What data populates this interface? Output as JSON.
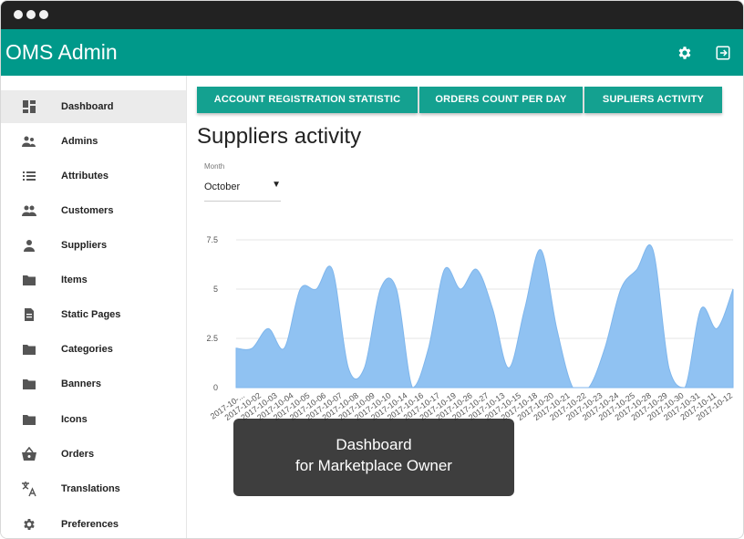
{
  "app": {
    "title": "OMS Admin"
  },
  "header": {
    "icons": [
      "settings-gear-icon",
      "logout-icon"
    ]
  },
  "sidebar": {
    "items": [
      {
        "label": "Dashboard",
        "icon": "dashboard-icon",
        "active": true
      },
      {
        "label": "Admins",
        "icon": "admins-icon"
      },
      {
        "label": "Attributes",
        "icon": "list-icon"
      },
      {
        "label": "Customers",
        "icon": "customers-icon"
      },
      {
        "label": "Suppliers",
        "icon": "person-icon"
      },
      {
        "label": "Items",
        "icon": "folder-icon"
      },
      {
        "label": "Static Pages",
        "icon": "document-icon"
      },
      {
        "label": "Categories",
        "icon": "folder-icon"
      },
      {
        "label": "Banners",
        "icon": "folder-icon"
      },
      {
        "label": "Icons",
        "icon": "folder-icon"
      },
      {
        "label": "Orders",
        "icon": "basket-icon"
      },
      {
        "label": "Translations",
        "icon": "translate-icon"
      },
      {
        "label": "Preferences",
        "icon": "gear-icon"
      }
    ]
  },
  "tabs": [
    {
      "label": "ACCOUNT REGISTRATION STATISTIC"
    },
    {
      "label": "ORDERS COUNT PER DAY"
    },
    {
      "label": "SUPLIERS ACTIVITY"
    }
  ],
  "main": {
    "title": "Suppliers activity",
    "month": {
      "label": "Month",
      "value": "October"
    }
  },
  "chart_data": {
    "type": "area",
    "x": [
      "2017-10-...",
      "2017-10-02",
      "2017-10-03",
      "2017-10-04",
      "2017-10-05",
      "2017-10-06",
      "2017-10-07",
      "2017-10-08",
      "2017-10-09",
      "2017-10-10",
      "2017-10-14",
      "2017-10-16",
      "2017-10-17",
      "2017-10-19",
      "2017-10-26",
      "2017-10-27",
      "2017-10-13",
      "2017-10-15",
      "2017-10-18",
      "2017-10-20",
      "2017-10-21",
      "2017-10-22",
      "2017-10-23",
      "2017-10-24",
      "2017-10-25",
      "2017-10-28",
      "2017-10-29",
      "2017-10-30",
      "2017-10-31",
      "2017-10-11",
      "2017-10-12"
    ],
    "values": [
      2,
      2,
      3,
      2,
      5,
      5,
      6,
      1,
      1,
      5,
      5,
      0,
      2,
      6,
      5,
      6,
      4,
      1,
      4,
      7,
      3,
      0,
      0,
      2,
      5,
      6,
      7,
      1,
      0,
      4,
      3,
      5
    ],
    "series": [
      {
        "values": [
          2,
          2,
          3,
          2,
          5,
          5,
          6,
          1,
          1,
          5,
          5,
          0,
          2,
          6,
          5,
          6,
          4,
          1,
          4,
          7,
          3,
          0,
          0,
          2,
          5,
          6,
          7,
          1,
          0,
          4,
          3,
          5
        ]
      }
    ],
    "yticks": [
      "0",
      "2.5",
      "5",
      "7.5"
    ],
    "ylim": [
      0,
      7.5
    ],
    "color": "#90c2f2",
    "grid": true
  },
  "overlay": {
    "line1": "Dashboard",
    "line2": "for Marketplace Owner"
  }
}
